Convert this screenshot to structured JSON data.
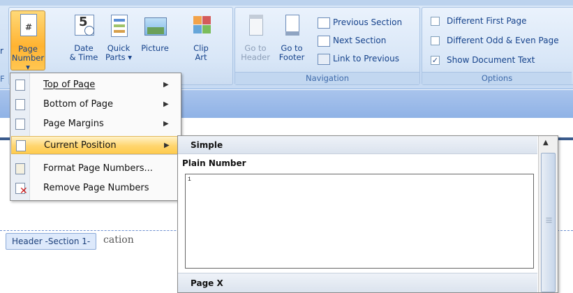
{
  "ribbon": {
    "left_cut_label": "r",
    "left_cut_group": "F",
    "insert_group": {
      "buttons": [
        {
          "label1": "Page",
          "label2": "Number ▾",
          "icon": "page-number-icon"
        },
        {
          "label1": "Date",
          "label2": "& Time",
          "icon": "calendar-icon"
        },
        {
          "label1": "Quick",
          "label2": "Parts ▾",
          "icon": "quick-parts-icon"
        },
        {
          "label1": "Picture",
          "label2": "",
          "icon": "picture-icon"
        },
        {
          "label1": "Clip",
          "label2": "Art",
          "icon": "clip-art-icon"
        }
      ]
    },
    "navigation_group": {
      "label": "Navigation",
      "go_to_header": {
        "label1": "Go to",
        "label2": "Header"
      },
      "go_to_footer": {
        "label1": "Go to",
        "label2": "Footer"
      },
      "previous_section": "Previous Section",
      "next_section": "Next Section",
      "link_to_previous": "Link to Previous"
    },
    "options_group": {
      "label": "Options",
      "items": [
        {
          "label": "Different First Page",
          "checked": false
        },
        {
          "label": "Different Odd & Even Page",
          "checked": false
        },
        {
          "label": "Show Document Text",
          "checked": true
        }
      ]
    }
  },
  "menu": {
    "items": [
      {
        "label": "Top of Page",
        "submenu": true
      },
      {
        "label": "Bottom of Page",
        "submenu": true
      },
      {
        "label": "Page Margins",
        "submenu": true
      },
      {
        "label": "Current Position",
        "submenu": true,
        "highlighted": true
      },
      {
        "label": "Format Page Numbers...",
        "submenu": false
      },
      {
        "label": "Remove Page Numbers",
        "submenu": false
      }
    ]
  },
  "gallery": {
    "category": "Simple",
    "first_item_title": "Plain Number",
    "preview_number": "1",
    "next_item_title": "Page X"
  },
  "document": {
    "header_tag": "Header -Section 1-",
    "visible_text": "cation"
  },
  "colors": {
    "ribbon_bg": "#d3e3f6",
    "highlight": "#ffd56e",
    "header_bar": "#a9c4ec"
  }
}
